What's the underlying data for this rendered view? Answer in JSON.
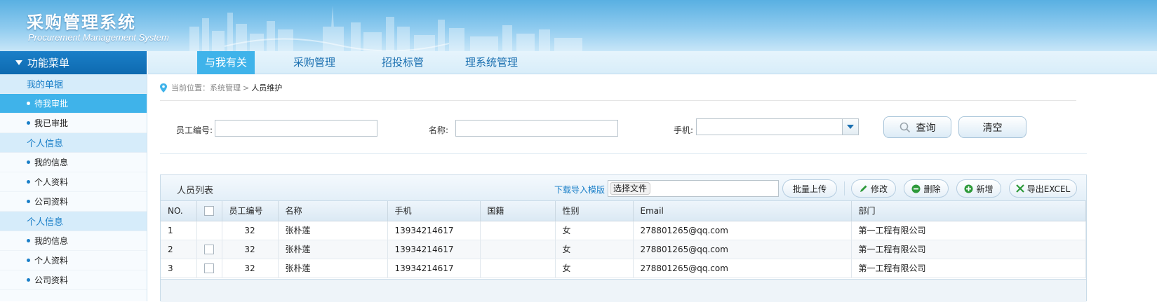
{
  "header": {
    "title": "采购管理系统",
    "subtitle": "Procurement Management System"
  },
  "sidebar": {
    "menu_title": "功能菜单",
    "groups": [
      {
        "label": "我的单据",
        "items": [
          {
            "label": "待我审批",
            "active": true
          },
          {
            "label": "我已审批"
          }
        ]
      },
      {
        "label": "个人信息",
        "items": [
          {
            "label": "我的信息"
          },
          {
            "label": "个人资料"
          },
          {
            "label": "公司资料"
          }
        ]
      },
      {
        "label": "个人信息",
        "items": [
          {
            "label": "我的信息"
          },
          {
            "label": "个人资料"
          },
          {
            "label": "公司资料"
          }
        ]
      }
    ]
  },
  "topnav": {
    "tabs": [
      {
        "label": "与我有关",
        "active": true
      },
      {
        "label": "采购管理"
      },
      {
        "label": "招投标管"
      },
      {
        "label": "理系统管理"
      }
    ]
  },
  "breadcrumb": {
    "prefix": "当前位置：系统管理",
    "sep": ">",
    "current": "人员维护"
  },
  "search": {
    "emp_no_label": "员工编号:",
    "emp_no_value": "",
    "name_label": "名称:",
    "name_value": "",
    "phone_label": "手机:",
    "phone_value": "",
    "query_label": "查询",
    "clear_label": "清空"
  },
  "list": {
    "title": "人员列表",
    "download_template": "下载导入模版",
    "choose_file": "选择文件",
    "batch_upload": "批量上传",
    "edit": "修改",
    "delete": "删除",
    "add": "新增",
    "export": "导出EXCEL",
    "columns": [
      "NO.",
      "",
      "员工编号",
      "名称",
      "手机",
      "国籍",
      "性别",
      "Email",
      "部门"
    ],
    "rows": [
      {
        "no": "1",
        "emp_no": "32",
        "name": "张朴莲",
        "phone": "13934214617",
        "nationality": "",
        "gender": "女",
        "email": "278801265@qq.com",
        "dept": "第一工程有限公司"
      },
      {
        "no": "2",
        "emp_no": "32",
        "name": "张朴莲",
        "phone": "13934214617",
        "nationality": "",
        "gender": "女",
        "email": "278801265@qq.com",
        "dept": "第一工程有限公司"
      },
      {
        "no": "3",
        "emp_no": "32",
        "name": "张朴莲",
        "phone": "13934214617",
        "nationality": "",
        "gender": "女",
        "email": "278801265@qq.com",
        "dept": "第一工程有限公司"
      }
    ]
  },
  "colors": {
    "brand_blue": "#1a7fc8",
    "active_tab": "#3fb3ea",
    "header_gradient_top": "#59b0e2"
  }
}
